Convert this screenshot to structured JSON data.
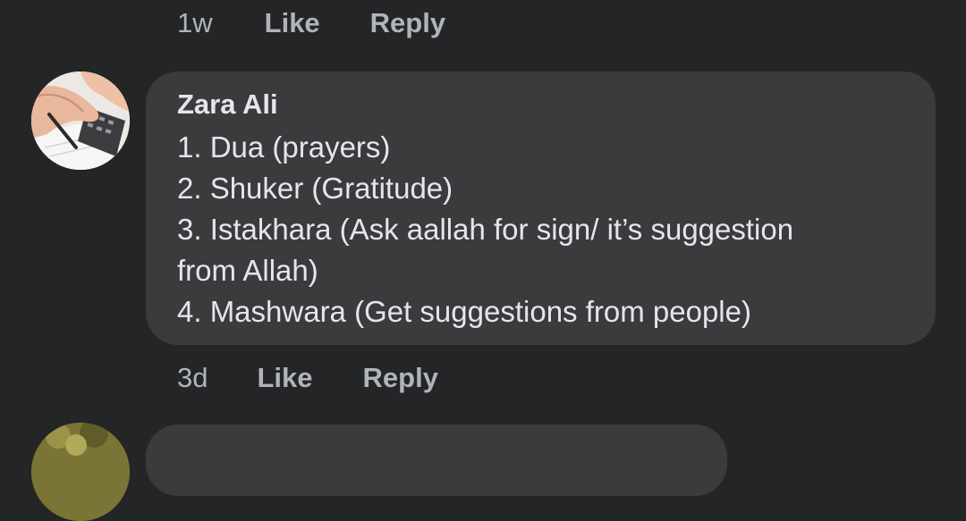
{
  "previous_comment": {
    "timestamp": "1w",
    "like_label": "Like",
    "reply_label": "Reply"
  },
  "comment": {
    "author": "Zara Ali",
    "avatar_icon": "calculator-hands-photo",
    "lines": [
      "1. Dua (prayers)",
      "2. Shuker (Gratitude)",
      "3. Istakhara (Ask aallah for sign/ it’s suggestion",
      "from Allah)",
      "4. Mashwara (Get suggestions from people)"
    ],
    "timestamp": "3d",
    "like_label": "Like",
    "reply_label": "Reply"
  },
  "next_comment": {
    "avatar_icon": "foliage-photo"
  },
  "colors": {
    "background": "#242526",
    "bubble": "#3a3b3c",
    "primary_text": "#e4e6eb",
    "secondary_text": "#b0b3b8"
  }
}
